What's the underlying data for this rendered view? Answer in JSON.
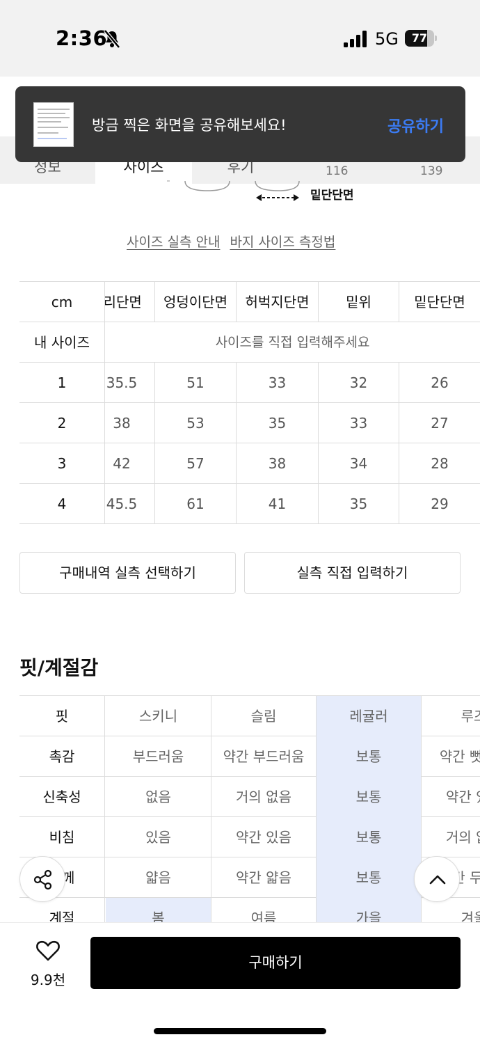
{
  "status_bar": {
    "time": "2:36",
    "network": "5G",
    "battery": "77",
    "battery_level": 0.77
  },
  "tabs": {
    "items": [
      "정보",
      "사이즈",
      "후기"
    ],
    "active": "사이즈",
    "values_behind": [
      "116",
      "139"
    ]
  },
  "toast": {
    "message": "방금 찍은 화면을 공유해보세요!",
    "action": "공유하기"
  },
  "illustration": {
    "hem_label": "밑단단면"
  },
  "guide_links": {
    "size_guide": "사이즈 실측 안내",
    "pants_measure": "바지 사이즈 측정법"
  },
  "size_table": {
    "unit_header": "cm",
    "columns": [
      "허리단면",
      "엉덩이단면",
      "허벅지단면",
      "밑위",
      "밑단단면"
    ],
    "my_size_label": "내 사이즈",
    "my_size_hint": "사이즈를 직접 입력해주세요",
    "rows": [
      {
        "label": "1",
        "values": [
          "35.5",
          "51",
          "33",
          "32",
          "26"
        ]
      },
      {
        "label": "2",
        "values": [
          "38",
          "53",
          "35",
          "33",
          "27"
        ]
      },
      {
        "label": "3",
        "values": [
          "42",
          "57",
          "38",
          "34",
          "28"
        ]
      },
      {
        "label": "4",
        "values": [
          "45.5",
          "61",
          "41",
          "35",
          "29"
        ]
      }
    ]
  },
  "buttons": {
    "select_from_orders": "구매내역 실측 선택하기",
    "input_manually": "실측 직접 입력하기"
  },
  "fit_section": {
    "title": "핏/계절감",
    "rows": [
      {
        "label": "핏",
        "values": [
          "스키니",
          "슬림",
          "레귤러",
          "루즈"
        ],
        "selected": [
          2
        ]
      },
      {
        "label": "촉감",
        "values": [
          "부드러움",
          "약간 부드러움",
          "보통",
          "약간 뻣뻣함"
        ],
        "selected": [
          2
        ]
      },
      {
        "label": "신축성",
        "values": [
          "없음",
          "거의 없음",
          "보통",
          "약간 있음"
        ],
        "selected": [
          2
        ]
      },
      {
        "label": "비침",
        "values": [
          "있음",
          "약간 있음",
          "보통",
          "거의 없음"
        ],
        "selected": [
          2
        ]
      },
      {
        "label": "두께",
        "values": [
          "얇음",
          "약간 얇음",
          "보통",
          "약간 두꺼움"
        ],
        "selected": [
          2
        ]
      },
      {
        "label": "계절",
        "values": [
          "봄",
          "여름",
          "가을",
          "겨울"
        ],
        "selected": [
          0,
          2
        ]
      }
    ]
  },
  "floating": {
    "share_icon": "share-icon",
    "top_icon": "chevron-up-icon"
  },
  "bottom_bar": {
    "like_count": "9.9천",
    "buy_label": "구매하기"
  },
  "colors": {
    "accent": "#3b7cf5",
    "highlight": "#e6ecfb",
    "toast_bg": "#363636",
    "buy_bg": "#000000"
  }
}
